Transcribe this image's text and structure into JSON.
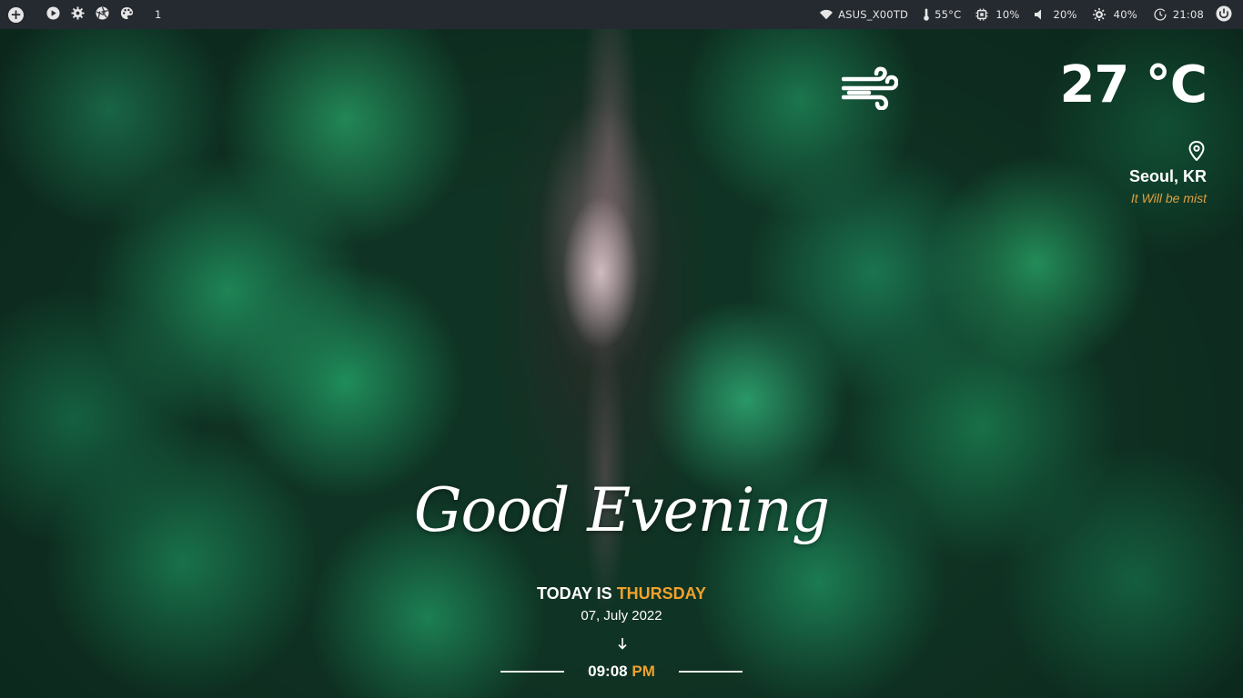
{
  "topbar": {
    "workspace": "1",
    "wifi_name": "ASUS_X00TD",
    "cpu_temp": "55°C",
    "cpu_usage": "10%",
    "volume": "20%",
    "brightness": "40%",
    "time": "21:08"
  },
  "weather": {
    "temperature": "27 °C",
    "location": "Seoul, KR",
    "description": "It Will be mist",
    "icon": "wind-icon"
  },
  "greeting": {
    "text": "Good Evening",
    "today_prefix": "TODAY IS",
    "day": "THURSDAY",
    "date": "07, July 2022",
    "time": "09:08",
    "meridiem": "PM"
  },
  "colors": {
    "bar_bg": "#252a30",
    "accent": "#f0a22c"
  }
}
